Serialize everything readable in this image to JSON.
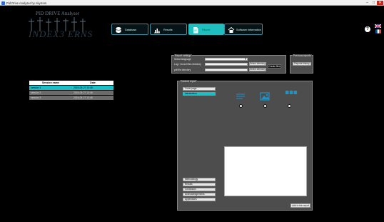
{
  "window": {
    "title": "Pid Drive Analyser by Akyrrem",
    "min": "–",
    "max": "□",
    "close": "✕"
  },
  "logo": {
    "subtitle": "PID DRIVE Analyser",
    "main": "INDEX3 ERNS"
  },
  "nav": {
    "tabs": [
      {
        "label": "Database",
        "icon": "database-icon"
      },
      {
        "label": "Results",
        "icon": "results-chart-icon"
      },
      {
        "label": "Report",
        "icon": "report-document-icon"
      },
      {
        "label": "Software information",
        "icon": "home-icon"
      }
    ],
    "help": "?"
  },
  "sessions": {
    "headers": [
      "Session name",
      "Date"
    ],
    "rows": [
      {
        "name": "session 1",
        "date": "2024-05-27 13:45"
      },
      {
        "name": "session 2",
        "date": "2024-05-27 13:46"
      },
      {
        "name": "session 3",
        "date": "2024-05-27 13:48"
      }
    ]
  },
  "report_settings": {
    "legend": "Report settings",
    "language_label": "Select language",
    "log_label": "Log / record files directory",
    "pdf_label": "pdf file directory",
    "select_directory": "Select directory",
    "create_files": "Create files"
  },
  "previous_reports": {
    "legend": "Previous reports",
    "button": "Reports history"
  },
  "content": {
    "legend": "Content report",
    "sections_top": [
      "Cover page",
      "Introduction"
    ],
    "sections_bottom": [
      "Methodology",
      "Results",
      "Conclusion",
      "Acknowledgements",
      "Appendices"
    ],
    "add_button": "Add to the report"
  }
}
